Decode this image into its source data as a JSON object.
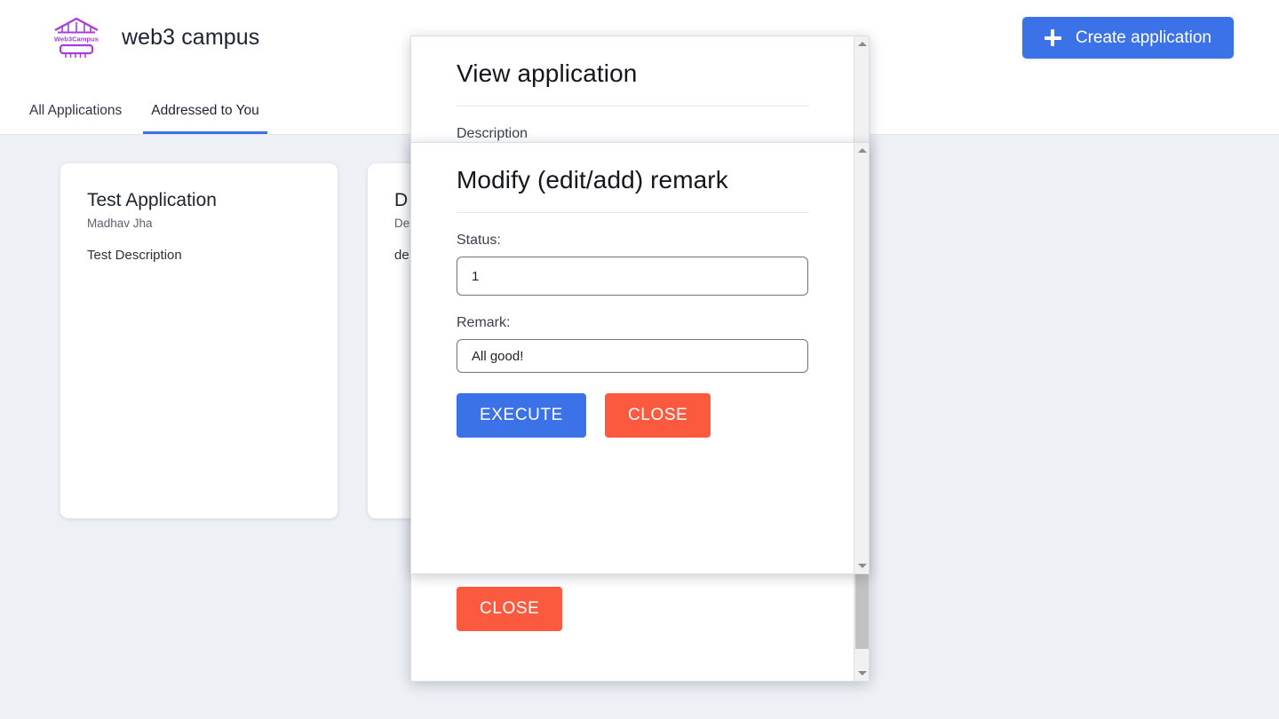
{
  "header": {
    "brand_title": "web3 campus",
    "logo_text": "Web3Campus",
    "logo_icon": "campus-building-icon",
    "create_button_label": "Create application",
    "create_button_icon": "plus-icon",
    "accent_blue": "#3c72e8"
  },
  "tabs": [
    {
      "label": "All Applications",
      "active": false
    },
    {
      "label": "Addressed to You",
      "active": true
    }
  ],
  "cards": [
    {
      "title": "Test Application",
      "author": "Madhav Jha",
      "description": "Test Description"
    },
    {
      "title": "D",
      "author": "De",
      "description": "de"
    }
  ],
  "view_modal": {
    "title": "View application",
    "description_label": "Description",
    "close_label": "CLOSE",
    "scrollbar": {
      "up_icon": "chevron-up-icon",
      "down_icon": "chevron-down-icon"
    }
  },
  "remark_modal": {
    "title": "Modify (edit/add) remark",
    "status_label": "Status:",
    "status_value": "1",
    "status_placeholder": "",
    "remark_label": "Remark:",
    "remark_value": "All good!",
    "remark_placeholder": "",
    "execute_label": "EXECUTE",
    "close_label": "CLOSE",
    "execute_color": "#3c72e8",
    "close_color": "#fb5a3f",
    "scrollbar": {
      "up_icon": "chevron-up-icon",
      "down_icon": "chevron-down-icon"
    }
  },
  "theme": {
    "page_background": "#edf0f5",
    "surface": "#ffffff"
  }
}
